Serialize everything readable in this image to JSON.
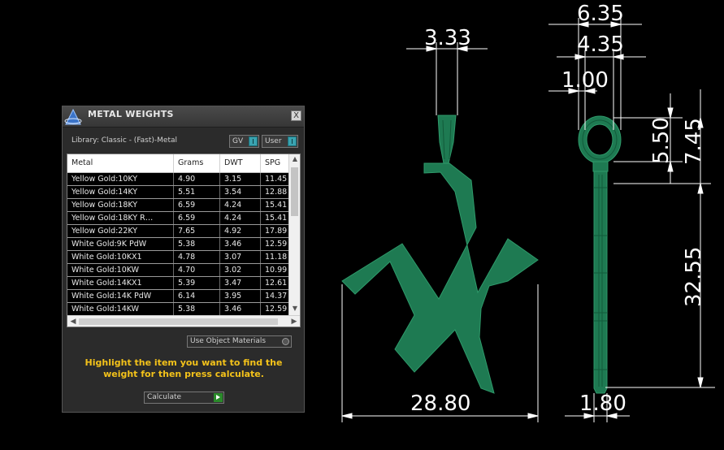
{
  "panel": {
    "title": "METAL WEIGHTS",
    "close_label": "X",
    "library_label": "Library: Classic - (Fast)-Metal",
    "toggle_gv": "GV",
    "toggle_user": "User",
    "columns": [
      "Metal",
      "Grams",
      "DWT",
      "SPG"
    ],
    "rows": [
      [
        "Yellow Gold:10KY",
        "4.90",
        "3.15",
        "11.45"
      ],
      [
        "Yellow Gold:14KY",
        "5.51",
        "3.54",
        "12.88"
      ],
      [
        "Yellow Gold:18KY",
        "6.59",
        "4.24",
        "15.41"
      ],
      [
        "Yellow Gold:18KY R…",
        "6.59",
        "4.24",
        "15.41"
      ],
      [
        "Yellow Gold:22KY",
        "7.65",
        "4.92",
        "17.89"
      ],
      [
        "White Gold:9K PdW",
        "5.38",
        "3.46",
        "12.59"
      ],
      [
        "White Gold:10KX1",
        "4.78",
        "3.07",
        "11.18"
      ],
      [
        "White Gold:10KW",
        "4.70",
        "3.02",
        "10.99"
      ],
      [
        "White Gold:14KX1",
        "5.39",
        "3.47",
        "12.61"
      ],
      [
        "White Gold:14K PdW",
        "6.14",
        "3.95",
        "14.37"
      ],
      [
        "White Gold:14KW",
        "5.38",
        "3.46",
        "12.59"
      ]
    ],
    "use_object_materials": "Use Object Materials",
    "hint": "Highlight the item you want to find the weight for then press calculate.",
    "calculate_label": "Calculate"
  },
  "drawing": {
    "model_color": "#1e7a52",
    "dimensions": {
      "bail_width": "3.33",
      "overall_depth": "6.35",
      "inner_depth": "4.35",
      "wall": "1.00",
      "ring_inner": "5.50",
      "ring_outer": "7.45",
      "body_height": "32.55",
      "letter_width": "28.80",
      "thickness": "1.80"
    }
  }
}
